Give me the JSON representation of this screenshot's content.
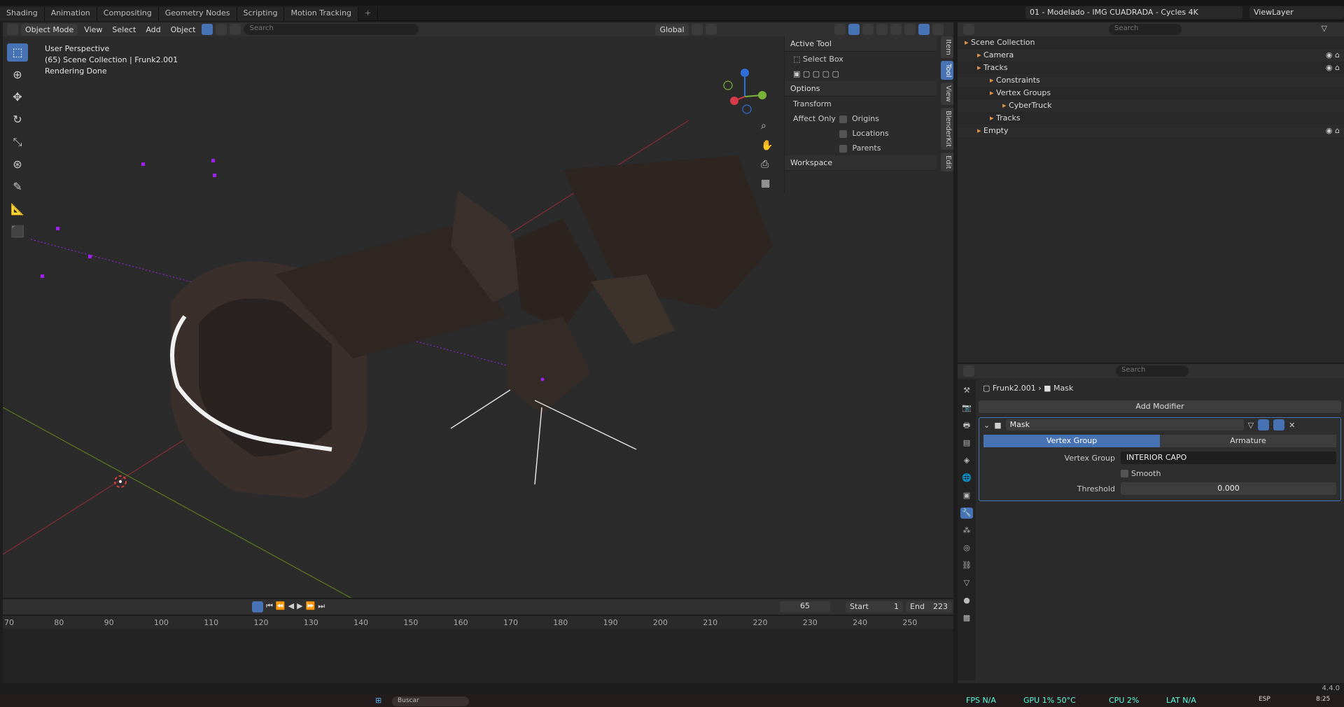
{
  "workspace_tabs": [
    "Shading",
    "Animation",
    "Compositing",
    "Geometry Nodes",
    "Scripting",
    "Motion Tracking",
    "+"
  ],
  "scene_selector": "01 - Modelado - IMG CUADRADA - Cycles 4K",
  "view_layer": "ViewLayer",
  "viewport": {
    "mode": "Object Mode",
    "menus": [
      "View",
      "Select",
      "Add",
      "Object"
    ],
    "search_placeholder": "Search",
    "orientation": "Global",
    "info": [
      "User Perspective",
      "(65) Scene Collection | Frunk2.001",
      "Rendering Done"
    ],
    "toolbar_icons": [
      "select-box-icon",
      "cursor-icon",
      "move-icon",
      "rotate-icon",
      "scale-icon",
      "transform-icon",
      "annotate-icon",
      "measure-icon",
      "add-cube-icon"
    ]
  },
  "n_panel": {
    "active_tool_title": "Active Tool",
    "active_tool_name": "Select Box",
    "options_title": "Options",
    "transform_title": "Transform",
    "affect_only_label": "Affect Only",
    "checkboxes": [
      "Origins",
      "Locations",
      "Parents"
    ],
    "workspace_title": "Workspace",
    "side_tabs": [
      "Item",
      "Tool",
      "View",
      "BlenderKit",
      "Edit"
    ]
  },
  "timeline": {
    "current_frame": "65",
    "start_label": "Start",
    "start_value": "1",
    "end_label": "End",
    "end_value": "223",
    "ticks": [
      "70",
      "80",
      "90",
      "100",
      "110",
      "120",
      "130",
      "140",
      "150",
      "160",
      "170",
      "180",
      "190",
      "200",
      "210",
      "220",
      "230",
      "240",
      "250"
    ]
  },
  "outliner": {
    "search_placeholder": "Search",
    "rows": [
      {
        "label": "Scene Collection",
        "indent": 0
      },
      {
        "label": "Camera",
        "indent": 1
      },
      {
        "label": "Tracks",
        "indent": 1
      },
      {
        "label": "Constraints",
        "indent": 2
      },
      {
        "label": "Vertex Groups",
        "indent": 2
      },
      {
        "label": "CyberTruck",
        "indent": 3
      },
      {
        "label": "Tracks",
        "indent": 2
      },
      {
        "label": "Empty",
        "indent": 1
      }
    ]
  },
  "properties": {
    "search_placeholder": "Search",
    "object_name": "Frunk2.001",
    "modifier_crumb": "Mask",
    "add_modifier_label": "Add Modifier",
    "modifier_name": "Mask",
    "mode_options": [
      "Vertex Group",
      "Armature"
    ],
    "vertex_group_label": "Vertex Group",
    "vertex_group_value": "INTERIOR CAPO",
    "smooth_label": "Smooth",
    "threshold_label": "Threshold",
    "threshold_value": "0.000"
  },
  "status": {
    "version": "4.4.0",
    "fps": "FPS N/A",
    "gpu": "GPU 1% 50°C",
    "cpu": "CPU 2%",
    "lat": "LAT N/A",
    "lang": "ESP",
    "time": "8:25",
    "taskbar_search": "Buscar"
  },
  "colors": {
    "accent": "#4772b3",
    "grid_x_axis": "#8b2b36",
    "grid_y_axis": "#5b7a1e",
    "selection_dot": "#a020f0"
  }
}
